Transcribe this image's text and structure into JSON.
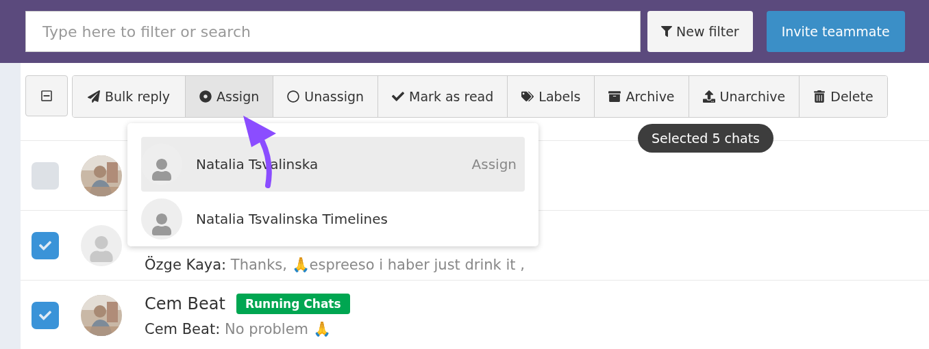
{
  "search": {
    "placeholder": "Type here to filter or search"
  },
  "new_filter": {
    "label": "New filter"
  },
  "invite": {
    "label": "Invite teammate"
  },
  "actions": [
    {
      "label": "Bulk reply",
      "selected": false
    },
    {
      "label": "Assign",
      "selected": true
    },
    {
      "label": "Unassign",
      "selected": false
    },
    {
      "label": "Mark as read",
      "selected": false
    },
    {
      "label": "Labels",
      "selected": false
    },
    {
      "label": "Archive",
      "selected": false
    },
    {
      "label": "Unarchive",
      "selected": false
    },
    {
      "label": "Delete",
      "selected": false
    }
  ],
  "assign_menu": [
    {
      "name": "Natalia Tsvalinska",
      "action": "Assign",
      "selected": true
    },
    {
      "name": "Natalia Tsvalinska Timelines",
      "selected": false
    }
  ],
  "tooltip": "Selected 5 chats",
  "chats": [
    {
      "checked": false,
      "has_photo": true
    },
    {
      "checked": true,
      "has_photo": false,
      "sender": "Özge Kaya:",
      "message": "Thanks, 🙏espreeso i haber just drink it ,"
    },
    {
      "checked": true,
      "has_photo": true,
      "name": "Cem Beat",
      "tag": {
        "label": "Running Chats",
        "color": "#00a651"
      },
      "sender": "Cem Beat:",
      "message": "No problem 🙏"
    }
  ]
}
